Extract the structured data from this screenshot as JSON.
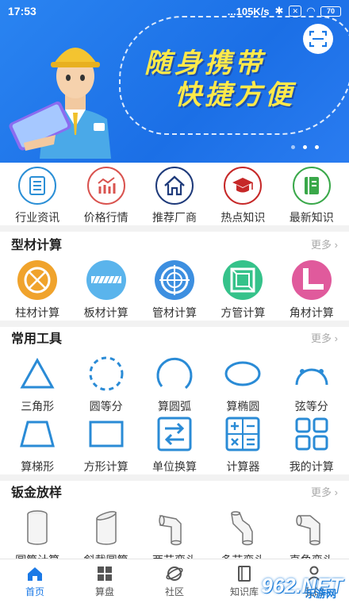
{
  "status": {
    "time": "17:53",
    "speed": "...105K/s",
    "battery": "70"
  },
  "banner": {
    "line1": "随身携带",
    "line2": "快捷方便"
  },
  "quicknav": [
    {
      "label": "行业资讯",
      "color": "#2b8fd6",
      "icon": "news-icon"
    },
    {
      "label": "价格行情",
      "color": "#d9534f",
      "icon": "price-chart-icon"
    },
    {
      "label": "推荐厂商",
      "color": "#1e3a7a",
      "icon": "house-icon"
    },
    {
      "label": "热点知识",
      "color": "#c62828",
      "icon": "graduation-cap-icon"
    },
    {
      "label": "最新知识",
      "color": "#3aa84a",
      "icon": "book-icon"
    }
  ],
  "sections": {
    "profile": {
      "title": "型材计算",
      "more": "更多 ›"
    },
    "tools": {
      "title": "常用工具",
      "more": "更多 ›"
    },
    "sheet": {
      "title": "钣金放样",
      "more": "更多 ›"
    }
  },
  "profile_items": [
    {
      "label": "柱材计算",
      "color": "#f0a32c"
    },
    {
      "label": "板材计算",
      "color": "#5ab4ec"
    },
    {
      "label": "管材计算",
      "color": "#3d8fe0"
    },
    {
      "label": "方管计算",
      "color": "#35c28a"
    },
    {
      "label": "角材计算",
      "color": "#e05a9c"
    }
  ],
  "tools_row1": [
    {
      "label": "三角形",
      "icon": "triangle-icon"
    },
    {
      "label": "圆等分",
      "icon": "dashed-circle-icon"
    },
    {
      "label": "算圆弧",
      "icon": "arc-icon"
    },
    {
      "label": "算椭圆",
      "icon": "ellipse-icon"
    },
    {
      "label": "弦等分",
      "icon": "chord-icon"
    }
  ],
  "tools_row2": [
    {
      "label": "算梯形",
      "icon": "trapezoid-icon"
    },
    {
      "label": "方形计算",
      "icon": "rectangle-icon"
    },
    {
      "label": "单位换算",
      "icon": "unit-convert-icon"
    },
    {
      "label": "计算器",
      "icon": "calculator-icon"
    },
    {
      "label": "我的计算",
      "icon": "grid-icon"
    }
  ],
  "sheet_items": [
    {
      "label": "圆筒计算"
    },
    {
      "label": "斜截圆筒"
    },
    {
      "label": "两节弯头"
    },
    {
      "label": "多节弯头"
    },
    {
      "label": "直角弯头"
    }
  ],
  "bottomnav": [
    {
      "label": "首页",
      "icon": "home-icon"
    },
    {
      "label": "算盘",
      "icon": "grid-icon"
    },
    {
      "label": "社区",
      "icon": "planet-icon"
    },
    {
      "label": "知识库",
      "icon": "book-icon"
    },
    {
      "label": "我的",
      "icon": "user-icon"
    }
  ],
  "watermark": {
    "main": "962.NET",
    "sub": "乐游网"
  },
  "colors": {
    "accent": "#1b79e6",
    "tool_stroke": "#2a8bd6"
  }
}
